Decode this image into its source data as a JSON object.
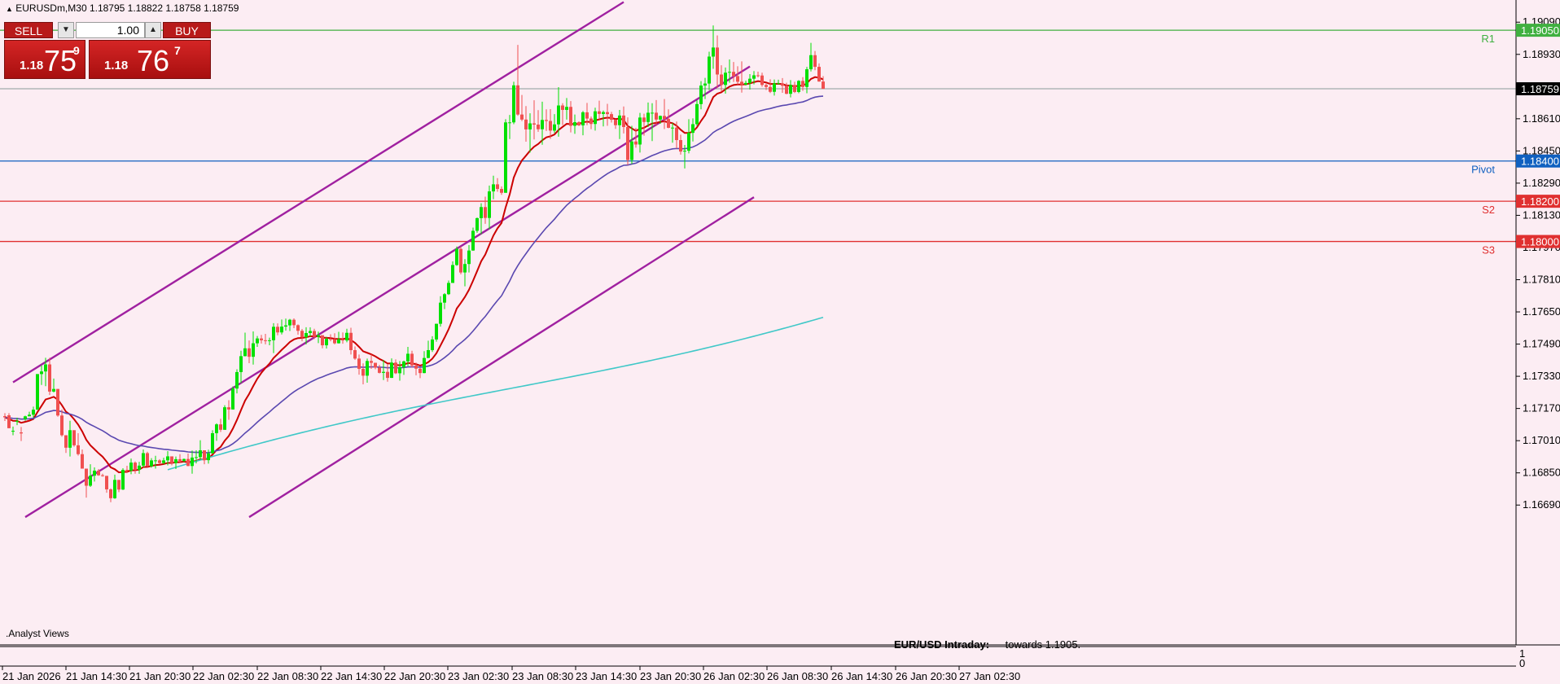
{
  "header": {
    "symbol_info": "EURUSDm,M30  1.18795 1.18822 1.18758 1.18759"
  },
  "trade_panel": {
    "sell_label": "SELL",
    "buy_label": "BUY",
    "lot_value": "1.00",
    "sell_price_small": "1.18",
    "sell_price_big": "75",
    "sell_price_sup": "9",
    "buy_price_small": "1.18",
    "buy_price_big": "76",
    "buy_price_sup": "7"
  },
  "subwindow": {
    "name": ".Analyst Views",
    "comment_title": "EUR/USD Intraday:",
    "comment_text": "towards 1.1905.",
    "scale_top": "1",
    "scale_bottom": "0"
  },
  "colors": {
    "background": "#fcedf3",
    "bull": "#00e000",
    "bear": "#f05050",
    "channel": "#a020a0",
    "ma_fast": "#cc0000",
    "ma_mid": "#5a48b0",
    "ma_slow": "#40c8c8",
    "r1": "#40b040",
    "pivot": "#1060c0",
    "support": "#e03030"
  },
  "chart_data": {
    "type": "candlestick",
    "ylim": [
      1.1661,
      1.1918
    ],
    "y_ticks": [
      "1.19090",
      "1.18930",
      "1.18610",
      "1.18450",
      "1.18290",
      "1.18130",
      "1.17970",
      "1.17810",
      "1.17650",
      "1.17490",
      "1.17330",
      "1.17170",
      "1.17010",
      "1.16850",
      "1.16690"
    ],
    "x_ticks": [
      "21 Jan 2026",
      "21 Jan 14:30",
      "21 Jan 20:30",
      "22 Jan 02:30",
      "22 Jan 08:30",
      "22 Jan 14:30",
      "22 Jan 20:30",
      "23 Jan 02:30",
      "23 Jan 08:30",
      "23 Jan 14:30",
      "23 Jan 20:30",
      "26 Jan 02:30",
      "26 Jan 08:30",
      "26 Jan 14:30",
      "26 Jan 20:30",
      "27 Jan 02:30"
    ],
    "bar_count": 238,
    "current_price": "1.18759",
    "levels": [
      {
        "name": "R1",
        "value": 1.1905,
        "label": "1.19050"
      },
      {
        "name": "Pivot",
        "value": 1.184,
        "label": "1.18400"
      },
      {
        "name": "S2",
        "value": 1.182,
        "label": "1.18200"
      },
      {
        "name": "S3",
        "value": 1.18,
        "label": "1.18000"
      }
    ],
    "channel": {
      "upper": [
        [
          2,
          1.173
        ],
        [
          152,
          1.1919
        ]
      ],
      "middle": [
        [
          5,
          1.1663
        ],
        [
          183,
          1.1887
        ]
      ],
      "lower": [
        [
          60,
          1.1663
        ],
        [
          184,
          1.1822
        ]
      ]
    },
    "candles": [
      [
        1.17132,
        1.17147,
        1.17108,
        1.17126
      ],
      [
        1.17136,
        1.17147,
        1.17072,
        1.17072
      ],
      [
        1.17059,
        1.1708,
        1.17037,
        1.17059
      ],
      [
        1.17104,
        1.17124,
        1.17087,
        1.17108
      ],
      [
        1.17051,
        1.17078,
        1.17008,
        1.17046
      ],
      [
        1.17117,
        1.17134,
        1.17109,
        1.17131
      ],
      [
        1.17131,
        1.17154,
        1.17131,
        1.17139
      ],
      [
        1.17139,
        1.17179,
        1.17124,
        1.17164
      ],
      [
        1.17164,
        1.17341,
        1.17164,
        1.17341
      ],
      [
        1.17341,
        1.17384,
        1.17287,
        1.17354
      ],
      [
        1.17354,
        1.17422,
        1.17281,
        1.17389
      ],
      [
        1.17389,
        1.17422,
        1.17237,
        1.17254
      ],
      [
        1.17254,
        1.17319,
        1.1725,
        1.17267
      ],
      [
        1.17267,
        1.17267,
        1.17129,
        1.17135
      ],
      [
        1.17135,
        1.17165,
        1.1703,
        1.17037
      ],
      [
        1.17037,
        1.17037,
        1.16949,
        1.16975
      ],
      [
        1.16975,
        1.17109,
        1.16931,
        1.17062
      ],
      [
        1.17062,
        1.17062,
        1.1698,
        1.16987
      ],
      [
        1.16987,
        1.17047,
        1.16936,
        1.16943
      ],
      [
        1.16943,
        1.16966,
        1.16871,
        1.16871
      ],
      [
        1.16871,
        1.16871,
        1.16727,
        1.16786
      ],
      [
        1.16786,
        1.16893,
        1.1678,
        1.16836
      ],
      [
        1.16836,
        1.16877,
        1.16807,
        1.16861
      ],
      [
        1.16861,
        1.16869,
        1.16835,
        1.16838
      ],
      [
        1.16838,
        1.16846,
        1.16831,
        1.16835
      ],
      [
        1.16835,
        1.16835,
        1.16751,
        1.16768
      ],
      [
        1.16768,
        1.16773,
        1.16704,
        1.16724
      ],
      [
        1.16724,
        1.16841,
        1.16721,
        1.16815
      ],
      [
        1.16815,
        1.16815,
        1.16754,
        1.16767
      ],
      [
        1.16767,
        1.16873,
        1.16765,
        1.16865
      ],
      [
        1.16865,
        1.16885,
        1.16849,
        1.16861
      ],
      [
        1.16861,
        1.16921,
        1.16843,
        1.16901
      ],
      [
        1.16901,
        1.16907,
        1.16846,
        1.16865
      ],
      [
        1.16865,
        1.16905,
        1.16845,
        1.16886
      ],
      [
        1.16886,
        1.16966,
        1.16876,
        1.16948
      ],
      [
        1.16948,
        1.16955,
        1.16879,
        1.16883
      ],
      [
        1.16883,
        1.16923,
        1.16876,
        1.16912
      ],
      [
        1.16912,
        1.16935,
        1.16871,
        1.16912
      ],
      [
        1.16912,
        1.16918,
        1.16893,
        1.16899
      ],
      [
        1.16899,
        1.16925,
        1.16893,
        1.16912
      ],
      [
        1.16912,
        1.16958,
        1.16887,
        1.16932
      ],
      [
        1.16932,
        1.16932,
        1.16887,
        1.16899
      ],
      [
        1.16899,
        1.16931,
        1.16869,
        1.16918
      ],
      [
        1.16918,
        1.16943,
        1.16902,
        1.16909
      ],
      [
        1.16909,
        1.16921,
        1.16902,
        1.16919
      ],
      [
        1.16919,
        1.16946,
        1.16883,
        1.16884
      ],
      [
        1.16884,
        1.16961,
        1.16846,
        1.16926
      ],
      [
        1.16926,
        1.16962,
        1.16897,
        1.16928
      ],
      [
        1.16928,
        1.17012,
        1.16915,
        1.16962
      ],
      [
        1.16962,
        1.16962,
        1.16893,
        1.16913
      ],
      [
        1.16913,
        1.16965,
        1.16896,
        1.16947
      ],
      [
        1.16947,
        1.17062,
        1.16947,
        1.17047
      ],
      [
        1.17047,
        1.17096,
        1.17009,
        1.17091
      ],
      [
        1.17091,
        1.17119,
        1.17053,
        1.17064
      ],
      [
        1.17064,
        1.17186,
        1.17064,
        1.17176
      ],
      [
        1.17176,
        1.17211,
        1.17114,
        1.17165
      ],
      [
        1.17165,
        1.1728,
        1.17165,
        1.17269
      ],
      [
        1.17269,
        1.17365,
        1.17245,
        1.17351
      ],
      [
        1.17351,
        1.17457,
        1.17296,
        1.1743
      ],
      [
        1.1743,
        1.17547,
        1.17429,
        1.17469
      ],
      [
        1.17469,
        1.17508,
        1.17395,
        1.17427
      ],
      [
        1.17427,
        1.17553,
        1.17388,
        1.17494
      ],
      [
        1.17494,
        1.1753,
        1.17476,
        1.17518
      ],
      [
        1.17518,
        1.17536,
        1.17493,
        1.17509
      ],
      [
        1.17509,
        1.17541,
        1.17489,
        1.17506
      ],
      [
        1.17506,
        1.17522,
        1.17484,
        1.17509
      ],
      [
        1.17509,
        1.17594,
        1.17445,
        1.17576
      ],
      [
        1.17576,
        1.17593,
        1.17534,
        1.17548
      ],
      [
        1.17548,
        1.17612,
        1.17538,
        1.17577
      ],
      [
        1.17577,
        1.17617,
        1.17557,
        1.17583
      ],
      [
        1.17583,
        1.17615,
        1.17555,
        1.17611
      ],
      [
        1.17611,
        1.17618,
        1.17569,
        1.17584
      ],
      [
        1.17584,
        1.17588,
        1.17537,
        1.17556
      ],
      [
        1.17556,
        1.17565,
        1.17504,
        1.17524
      ],
      [
        1.17524,
        1.17574,
        1.17489,
        1.17545
      ],
      [
        1.17545,
        1.17573,
        1.17526,
        1.17555
      ],
      [
        1.17555,
        1.17566,
        1.17515,
        1.17526
      ],
      [
        1.17526,
        1.17552,
        1.17495,
        1.17534
      ],
      [
        1.17534,
        1.17534,
        1.17469,
        1.17484
      ],
      [
        1.17484,
        1.17526,
        1.17468,
        1.17516
      ],
      [
        1.17516,
        1.17539,
        1.17504,
        1.17513
      ],
      [
        1.17513,
        1.17544,
        1.17489,
        1.17494
      ],
      [
        1.17494,
        1.17551,
        1.17493,
        1.17514
      ],
      [
        1.17514,
        1.17548,
        1.17492,
        1.17508
      ],
      [
        1.17508,
        1.17566,
        1.17499,
        1.17546
      ],
      [
        1.17546,
        1.17571,
        1.17438,
        1.1746
      ],
      [
        1.1746,
        1.17478,
        1.17412,
        1.17418
      ],
      [
        1.17418,
        1.17438,
        1.17338,
        1.17367
      ],
      [
        1.17367,
        1.17394,
        1.1729,
        1.17333
      ],
      [
        1.17333,
        1.17418,
        1.17298,
        1.17406
      ],
      [
        1.17406,
        1.17439,
        1.17367,
        1.17397
      ],
      [
        1.17397,
        1.17397,
        1.17365,
        1.17373
      ],
      [
        1.17373,
        1.17387,
        1.17344,
        1.17347
      ],
      [
        1.17347,
        1.17411,
        1.17311,
        1.17352
      ],
      [
        1.17352,
        1.17391,
        1.17303,
        1.17322
      ],
      [
        1.17322,
        1.17419,
        1.17322,
        1.17398
      ],
      [
        1.17398,
        1.17414,
        1.17341,
        1.17345
      ],
      [
        1.17345,
        1.17406,
        1.17308,
        1.17375
      ],
      [
        1.17375,
        1.17408,
        1.17337,
        1.17404
      ],
      [
        1.17404,
        1.17476,
        1.17381,
        1.17442
      ],
      [
        1.17442,
        1.17457,
        1.17375,
        1.17384
      ],
      [
        1.17384,
        1.17398,
        1.17335,
        1.17368
      ],
      [
        1.17368,
        1.17373,
        1.17321,
        1.17346
      ],
      [
        1.17346,
        1.17455,
        1.17345,
        1.17421
      ],
      [
        1.17421,
        1.17507,
        1.1742,
        1.1746
      ],
      [
        1.1746,
        1.17529,
        1.17451,
        1.17513
      ],
      [
        1.17513,
        1.17591,
        1.17502,
        1.17591
      ],
      [
        1.17591,
        1.17728,
        1.17577,
        1.17696
      ],
      [
        1.17696,
        1.17743,
        1.17664,
        1.17738
      ],
      [
        1.17738,
        1.17806,
        1.17734,
        1.17794
      ],
      [
        1.17794,
        1.17901,
        1.17794,
        1.17883
      ],
      [
        1.17883,
        1.17975,
        1.17879,
        1.17963
      ],
      [
        1.17963,
        1.17975,
        1.17837,
        1.17846
      ],
      [
        1.17846,
        1.17912,
        1.17777,
        1.17888
      ],
      [
        1.17888,
        1.17982,
        1.17846,
        1.17955
      ],
      [
        1.17955,
        1.18069,
        1.17954,
        1.18053
      ],
      [
        1.18053,
        1.18119,
        1.18043,
        1.18116
      ],
      [
        1.18116,
        1.1819,
        1.18036,
        1.18171
      ],
      [
        1.18171,
        1.18223,
        1.18088,
        1.18117
      ],
      [
        1.18117,
        1.18278,
        1.18061,
        1.18249
      ],
      [
        1.18249,
        1.18327,
        1.1821,
        1.18284
      ],
      [
        1.18284,
        1.18315,
        1.18247,
        1.18261
      ],
      [
        1.18261,
        1.18274,
        1.18232,
        1.18242
      ],
      [
        1.18242,
        1.18608,
        1.18242,
        1.18592
      ],
      [
        1.18592,
        1.18629,
        1.18509,
        1.18592
      ],
      [
        1.18592,
        1.18794,
        1.18583,
        1.18776
      ],
      [
        1.18776,
        1.18977,
        1.18625,
        1.18631
      ],
      [
        1.18631,
        1.18728,
        1.18598,
        1.18606
      ],
      [
        1.18606,
        1.18673,
        1.18496,
        1.18557
      ],
      [
        1.18557,
        1.18637,
        1.18442,
        1.18587
      ],
      [
        1.18587,
        1.18702,
        1.18507,
        1.18581
      ],
      [
        1.18581,
        1.18653,
        1.18545,
        1.18558
      ],
      [
        1.18558,
        1.18695,
        1.18481,
        1.18604
      ],
      [
        1.18604,
        1.18657,
        1.18549,
        1.18599
      ],
      [
        1.18599,
        1.18658,
        1.1851,
        1.18551
      ],
      [
        1.18551,
        1.18633,
        1.18539,
        1.18582
      ],
      [
        1.18582,
        1.18767,
        1.18521,
        1.18676
      ],
      [
        1.18676,
        1.18687,
        1.18579,
        1.18654
      ],
      [
        1.18654,
        1.18713,
        1.18606,
        1.18669
      ],
      [
        1.18669,
        1.18698,
        1.18542,
        1.18575
      ],
      [
        1.18575,
        1.18631,
        1.18535,
        1.18593
      ],
      [
        1.18593,
        1.18597,
        1.18574,
        1.18577
      ],
      [
        1.18577,
        1.18649,
        1.18528,
        1.18642
      ],
      [
        1.18642,
        1.18689,
        1.18578,
        1.18611
      ],
      [
        1.18611,
        1.18621,
        1.18558,
        1.18584
      ],
      [
        1.18584,
        1.18665,
        1.18551,
        1.18647
      ],
      [
        1.18647,
        1.187,
        1.18605,
        1.18634
      ],
      [
        1.18634,
        1.18651,
        1.18572,
        1.18643
      ],
      [
        1.18643,
        1.18684,
        1.18575,
        1.18633
      ],
      [
        1.18633,
        1.18644,
        1.18591,
        1.18605
      ],
      [
        1.18605,
        1.18608,
        1.1856,
        1.18578
      ],
      [
        1.18578,
        1.18654,
        1.18509,
        1.18626
      ],
      [
        1.18626,
        1.18671,
        1.18537,
        1.18569
      ],
      [
        1.18569,
        1.18617,
        1.1838,
        1.18405
      ],
      [
        1.18405,
        1.18575,
        1.18385,
        1.18497
      ],
      [
        1.18497,
        1.18565,
        1.18466,
        1.18482
      ],
      [
        1.18482,
        1.18639,
        1.18442,
        1.18616
      ],
      [
        1.18616,
        1.18635,
        1.18526,
        1.18594
      ],
      [
        1.18594,
        1.18691,
        1.18569,
        1.1864
      ],
      [
        1.1864,
        1.18687,
        1.18499,
        1.1864
      ],
      [
        1.1864,
        1.18703,
        1.18574,
        1.18606
      ],
      [
        1.18606,
        1.18626,
        1.18585,
        1.18624
      ],
      [
        1.18624,
        1.18708,
        1.18559,
        1.18609
      ],
      [
        1.18609,
        1.18657,
        1.18563,
        1.18565
      ],
      [
        1.18565,
        1.18589,
        1.18491,
        1.18566
      ],
      [
        1.18566,
        1.18596,
        1.18462,
        1.18504
      ],
      [
        1.18504,
        1.18531,
        1.18432,
        1.18447
      ],
      [
        1.18447,
        1.1848,
        1.18363,
        1.18451
      ],
      [
        1.18451,
        1.18608,
        1.18438,
        1.1854
      ],
      [
        1.1854,
        1.18612,
        1.18497,
        1.18583
      ],
      [
        1.18583,
        1.18702,
        1.18574,
        1.18683
      ],
      [
        1.18683,
        1.18797,
        1.18657,
        1.18775
      ],
      [
        1.18775,
        1.18813,
        1.18708,
        1.18785
      ],
      [
        1.18785,
        1.18943,
        1.18752,
        1.18919
      ],
      [
        1.18919,
        1.19074,
        1.18858,
        1.18964
      ],
      [
        1.18964,
        1.19024,
        1.18763,
        1.1883
      ],
      [
        1.1883,
        1.18876,
        1.18745,
        1.18778
      ],
      [
        1.18778,
        1.18865,
        1.18735,
        1.18839
      ],
      [
        1.18839,
        1.18905,
        1.18789,
        1.18843
      ],
      [
        1.18843,
        1.18892,
        1.18793,
        1.18822
      ],
      [
        1.18822,
        1.18871,
        1.1878,
        1.18794
      ],
      [
        1.18794,
        1.18895,
        1.1874,
        1.1878
      ],
      [
        1.1878,
        1.18799,
        1.18776,
        1.18788
      ],
      [
        1.18788,
        1.18832,
        1.18755,
        1.18809
      ],
      [
        1.18809,
        1.18847,
        1.18781,
        1.18826
      ],
      [
        1.18826,
        1.18844,
        1.18816,
        1.18825
      ],
      [
        1.18825,
        1.18839,
        1.18769,
        1.18778
      ],
      [
        1.18778,
        1.18784,
        1.18753,
        1.18768
      ],
      [
        1.18768,
        1.18806,
        1.18738,
        1.18744
      ],
      [
        1.18744,
        1.18805,
        1.18725,
        1.18786
      ],
      [
        1.18786,
        1.18804,
        1.18785,
        1.18786
      ],
      [
        1.18786,
        1.18812,
        1.18739,
        1.18774
      ],
      [
        1.18774,
        1.18789,
        1.18732,
        1.18734
      ],
      [
        1.18734,
        1.18802,
        1.18716,
        1.18778
      ],
      [
        1.18778,
        1.18794,
        1.18738,
        1.18743
      ],
      [
        1.18743,
        1.18802,
        1.18737,
        1.18798
      ],
      [
        1.18798,
        1.18817,
        1.18749,
        1.18768
      ],
      [
        1.18768,
        1.18868,
        1.18737,
        1.18856
      ],
      [
        1.18856,
        1.18987,
        1.18845,
        1.18926
      ],
      [
        1.18926,
        1.18947,
        1.18851,
        1.18868
      ],
      [
        1.18868,
        1.18885,
        1.18794,
        1.18795
      ],
      [
        1.18795,
        1.18822,
        1.18758,
        1.18759
      ]
    ]
  }
}
